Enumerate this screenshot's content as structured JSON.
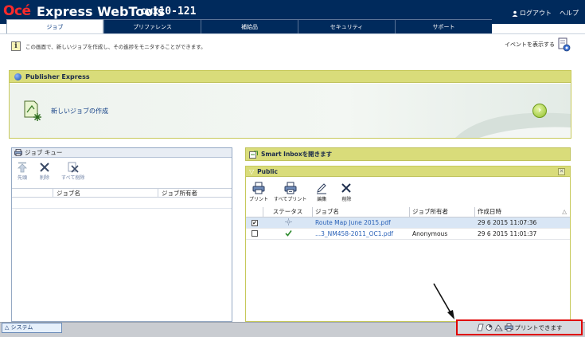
{
  "header": {
    "logo": "Océ",
    "title": "Express WebTools",
    "host": "cwx10-121",
    "logout": "ログアウト",
    "help": "ヘルプ"
  },
  "tabs": [
    {
      "label": "ジョブ",
      "active": true
    },
    {
      "label": "プリファレンス"
    },
    {
      "label": "補給品"
    },
    {
      "label": "セキュリティ"
    },
    {
      "label": "サポート"
    }
  ],
  "info": {
    "text": "この画面で、新しいジョブを作成し、その進捗をモニタすることができます。",
    "event_link": "イベントを表示する"
  },
  "publisher": {
    "title": "Publisher Express",
    "new_job": "新しいジョブの作成"
  },
  "queue": {
    "title": "ジョブ キュー",
    "tools": [
      "先頭",
      "削除",
      "すべて削除"
    ],
    "columns": [
      "ジョブ名",
      "ジョブ所有者"
    ]
  },
  "inbox": {
    "title": "Smart Inboxを開きます",
    "public_title": "Public",
    "tools": [
      "プリント",
      "すべてプリント",
      "編集",
      "削除"
    ],
    "columns": [
      "ステータス",
      "ジョブ名",
      "ジョブ所有者",
      "作成日時"
    ],
    "rows": [
      {
        "checked": true,
        "status": "waiting",
        "name": "Route Map June 2015.pdf",
        "owner": "",
        "date": "29 6 2015 11:07:36"
      },
      {
        "checked": false,
        "status": "done",
        "name": "...3_NM458-2011_OC1.pdf",
        "owner": "Anonymous",
        "date": "29 6 2015 11:01:37"
      }
    ]
  },
  "bottom": {
    "system_tab": "システム",
    "status_text": "プリントできます"
  }
}
